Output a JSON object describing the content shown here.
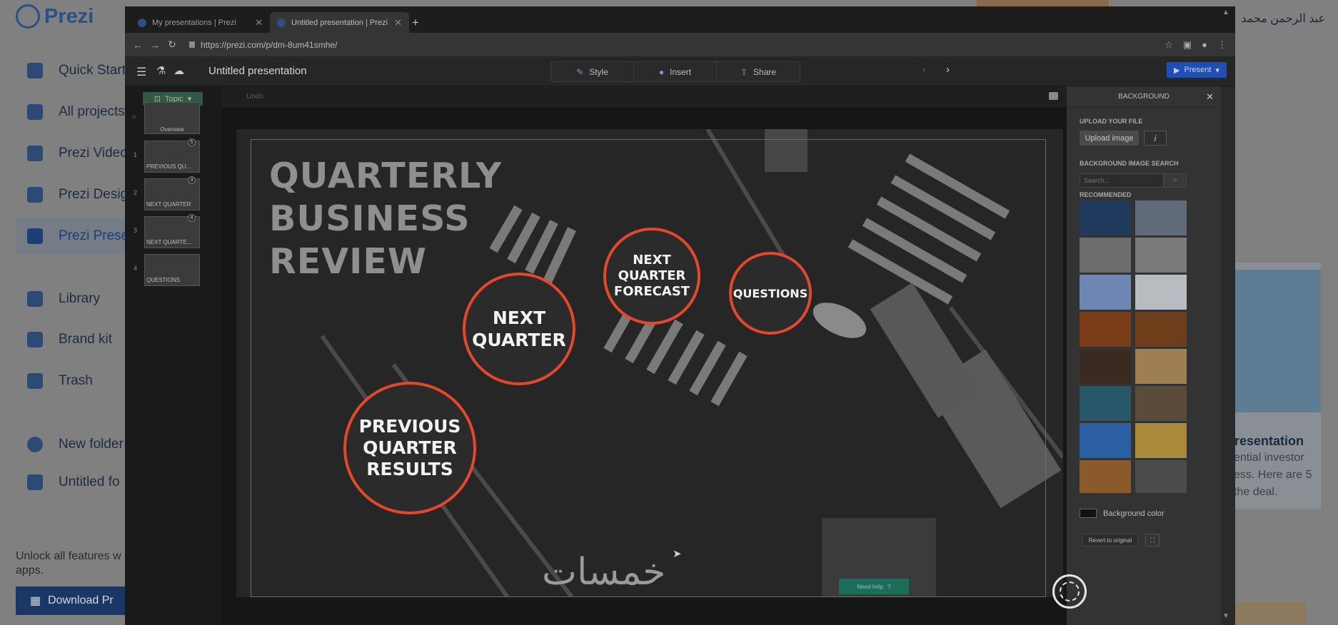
{
  "dashboard": {
    "logo_text": "Prezi",
    "nav": [
      {
        "label": "Quick Start"
      },
      {
        "label": "All projects"
      },
      {
        "label": "Prezi Video"
      },
      {
        "label": "Prezi Design"
      },
      {
        "label": "Prezi Prese"
      },
      {
        "label": "Library"
      },
      {
        "label": "Brand kit"
      },
      {
        "label": "Trash"
      },
      {
        "label": "New folder"
      },
      {
        "label": "Untitled fo"
      }
    ],
    "unlock_text": "Unlock all features w apps.",
    "download_label": "Download Pr",
    "user_name": "عبد الرحمن محمد",
    "card_title": "presentation",
    "card_text": "ential investor ess. Here are 5 the deal."
  },
  "browser": {
    "tabs": [
      {
        "label": "My presentations | Prezi"
      },
      {
        "label": "Untitled presentation | Prezi"
      }
    ],
    "url": "https://prezi.com/p/dm-8um41smhe/"
  },
  "editor": {
    "title": "Untitled presentation",
    "toolbar": {
      "style": "Style",
      "insert": "Insert",
      "share": "Share"
    },
    "present_label": "Present",
    "topic_label": "Topic",
    "undo_label": "Undo",
    "thumbnails": [
      {
        "num": "",
        "label": "Overview",
        "badge": ""
      },
      {
        "num": "1",
        "label": "PREVIOUS QU...",
        "badge": "5"
      },
      {
        "num": "2",
        "label": "NEXT QUARTER",
        "badge": "3"
      },
      {
        "num": "3",
        "label": "NEXT QUARTE...",
        "badge": "4"
      },
      {
        "num": "4",
        "label": "QUESTIONS",
        "badge": ""
      }
    ]
  },
  "slide": {
    "title_lines": [
      "QUARTERLY",
      "BUSINESS",
      "REVIEW"
    ],
    "circles": [
      {
        "lines": [
          "PREVIOUS",
          "QUARTER",
          "RESULTS"
        ]
      },
      {
        "lines": [
          "NEXT",
          "QUARTER"
        ]
      },
      {
        "lines": [
          "NEXT",
          "QUARTER",
          "FORECAST"
        ]
      },
      {
        "lines": [
          "QUESTIONS"
        ]
      }
    ],
    "watermark": "خمسات",
    "need_help": "Need help"
  },
  "background_panel": {
    "header": "BACKGROUND",
    "upload_section": "UPLOAD YOUR FILE",
    "upload_button": "Upload image",
    "info_button": "i",
    "search_section": "BACKGROUND IMAGE SEARCH",
    "search_placeholder": "Search...",
    "recommended_section": "RECOMMENDED",
    "tiles": [
      {
        "color": "#203a5e"
      },
      {
        "color": "#5f6b78"
      },
      {
        "color": "#6d6d6d"
      },
      {
        "color": "#7a7a7a"
      },
      {
        "color": "#6d86b4"
      },
      {
        "color": "#b8bcc0"
      },
      {
        "color": "#7a3b17"
      },
      {
        "color": "#6e3e1a"
      },
      {
        "color": "#3a2a1f"
      },
      {
        "color": "#9d7f52"
      },
      {
        "color": "#28576a"
      },
      {
        "color": "#5a4b3a"
      },
      {
        "color": "#2b5fa3"
      },
      {
        "color": "#a88a3a"
      },
      {
        "color": "#8b5a2a"
      },
      {
        "color": "#4b4b4b"
      }
    ],
    "bg_color_label": "Background color",
    "revert_label": "Revert to original"
  }
}
